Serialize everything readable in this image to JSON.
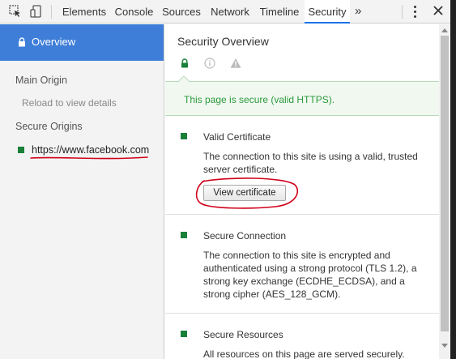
{
  "toolbar": {
    "tabs": [
      "Elements",
      "Console",
      "Sources",
      "Network",
      "Timeline",
      "Security"
    ],
    "active_tab": "Security",
    "more_tabs_glyph": "»",
    "icons": [
      "inspect-element-icon",
      "device-toolbar-icon",
      "more-options-icon",
      "close-icon"
    ]
  },
  "sidebar": {
    "overview_label": "Overview",
    "main_origin_heading": "Main Origin",
    "reload_hint": "Reload to view details",
    "secure_origins_heading": "Secure Origins",
    "secure_origin_url": "https://www.facebook.com"
  },
  "main": {
    "title": "Security Overview",
    "summary_icons": [
      "lock-icon",
      "info-icon",
      "warning-icon"
    ],
    "summary_text": "This page is secure (valid HTTPS).",
    "sections": [
      {
        "title": "Valid Certificate",
        "description": "The connection to this site is using a valid, trusted server certificate.",
        "button_label": "View certificate"
      },
      {
        "title": "Secure Connection",
        "description": "The connection to this site is encrypted and authenticated using a strong protocol (TLS 1.2), a strong key exchange (ECDHE_ECDSA), and a strong cipher (AES_128_GCM)."
      },
      {
        "title": "Secure Resources",
        "description": "All resources on this page are served securely."
      }
    ]
  },
  "colors": {
    "accent_blue": "#3e7ed8",
    "secure_green": "#188038",
    "secure_text_green": "#2a9a3b",
    "annotation_red": "#d0021b"
  }
}
